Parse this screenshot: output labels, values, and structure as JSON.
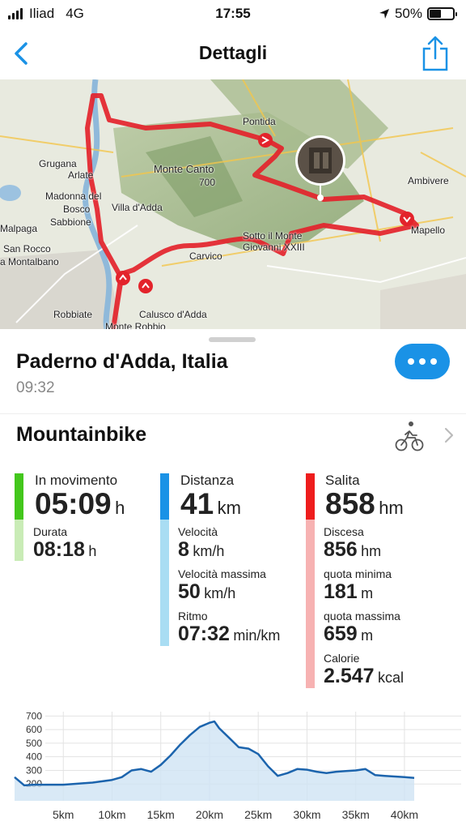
{
  "status_bar": {
    "carrier": "Iliad",
    "network": "4G",
    "time": "17:55",
    "battery": "50%",
    "battery_level": 0.5
  },
  "navbar": {
    "title": "Dettagli",
    "back_icon": "chevron-left-icon",
    "share_icon": "share-icon"
  },
  "map": {
    "labels": {
      "pontida": "Pontida",
      "grugana": "Grugana",
      "arlate": "Arlate",
      "monte_canto": "Monte Canto",
      "monte_canto_alt": "700",
      "ambivere": "Ambivere",
      "madonna": "Madonna del",
      "bosco": "Bosco",
      "villa": "Villa d'Adda",
      "sabbione": "Sabbione",
      "malpaga": "Malpaga",
      "mapello": "Mapello",
      "sotto": "Sotto il Monte",
      "giovanni": "Giovanni XXIII",
      "san_rocco": "San Rocco",
      "montalbano": "a Montalbano",
      "carvico": "Carvico",
      "robbiate": "Robbiate",
      "calusco": "Calusco d'Adda",
      "monte_robbio": "Monte Robbio"
    }
  },
  "summary": {
    "location": "Paderno d'Adda, Italia",
    "start_time": "09:32",
    "more_icon": "more-icon",
    "activity": "Mountainbike",
    "activity_icon": "mountain-bike-icon"
  },
  "stats": {
    "moving": {
      "label": "In movimento",
      "value": "05:09",
      "unit": "h"
    },
    "duration": {
      "label": "Durata",
      "value": "08:18",
      "unit": "h"
    },
    "distance": {
      "label": "Distanza",
      "value": "41",
      "unit": "km"
    },
    "speed": {
      "label": "Velocità",
      "value": "8",
      "unit": "km/h"
    },
    "max_speed": {
      "label": "Velocità massima",
      "value": "50",
      "unit": "km/h"
    },
    "pace": {
      "label": "Ritmo",
      "value": "07:32",
      "unit": "min/km"
    },
    "ascent": {
      "label": "Salita",
      "value": "858",
      "unit": "hm"
    },
    "descent": {
      "label": "Discesa",
      "value": "856",
      "unit": "hm"
    },
    "min_alt": {
      "label": "quota minima",
      "value": "181",
      "unit": "m"
    },
    "max_alt": {
      "label": "quota massima",
      "value": "659",
      "unit": "m"
    },
    "calories": {
      "label": "Calorie",
      "value": "2.547",
      "unit": "kcal"
    }
  },
  "colors": {
    "accent": "#1a92e6",
    "green": "#43c71c",
    "green_light": "#c9ecb6",
    "blue": "#1a92e6",
    "blue_light": "#a9ddf3",
    "red": "#ee1d1d",
    "red_light": "#f7b2b2",
    "route": "#e3232b",
    "profile": "#1c64ad"
  },
  "chart_data": {
    "type": "area",
    "x": [
      0,
      1,
      2,
      3,
      4,
      5,
      6,
      7,
      8,
      9,
      10,
      11,
      12,
      13,
      14,
      15,
      16,
      17,
      18,
      19,
      20,
      20.5,
      21,
      22,
      23,
      24,
      25,
      26,
      27,
      28,
      29,
      30,
      31,
      32,
      33,
      34,
      35,
      36,
      37,
      38,
      39,
      40,
      41
    ],
    "y": [
      250,
      190,
      195,
      195,
      195,
      195,
      200,
      205,
      210,
      220,
      230,
      250,
      300,
      310,
      290,
      340,
      410,
      490,
      560,
      620,
      650,
      660,
      610,
      540,
      470,
      460,
      420,
      330,
      260,
      280,
      310,
      305,
      290,
      280,
      290,
      295,
      300,
      310,
      265,
      260,
      255,
      250,
      245
    ],
    "xticks": [
      "5km",
      "10km",
      "15km",
      "20km",
      "25km",
      "30km",
      "35km",
      "40km"
    ],
    "xtick_values": [
      5,
      10,
      15,
      20,
      25,
      30,
      35,
      40
    ],
    "yticks": [
      "700",
      "600",
      "500",
      "400",
      "300",
      "200"
    ],
    "ytick_values": [
      700,
      600,
      500,
      400,
      300,
      200
    ],
    "xlim": [
      0,
      41.5
    ],
    "ylim": [
      100,
      720
    ],
    "xlabel": "",
    "ylabel": "",
    "grid": true
  }
}
